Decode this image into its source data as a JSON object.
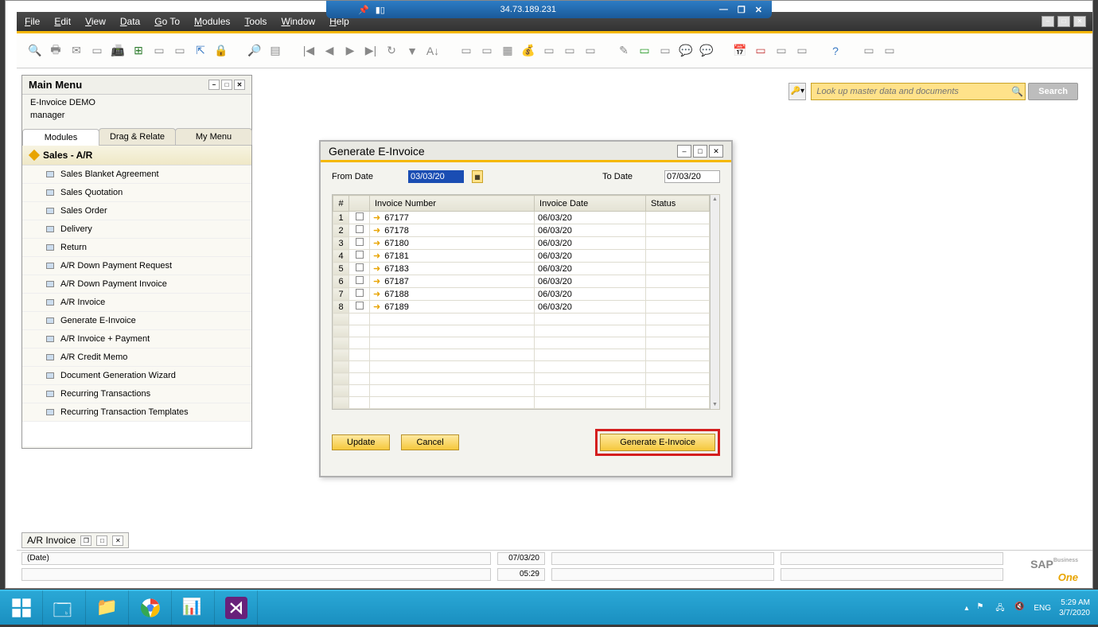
{
  "rdp": {
    "ip": "34.73.189.231"
  },
  "menus": {
    "file": "File",
    "edit": "Edit",
    "view": "View",
    "data": "Data",
    "goto": "Go To",
    "modules": "Modules",
    "tools": "Tools",
    "window": "Window",
    "help": "Help"
  },
  "search": {
    "placeholder": "Look up master data and documents",
    "button": "Search"
  },
  "main_menu": {
    "title": "Main Menu",
    "company": "E-Invoice DEMO",
    "user": "manager",
    "tabs": {
      "modules": "Modules",
      "drag": "Drag & Relate",
      "my": "My Menu"
    },
    "section": "Sales - A/R",
    "items": [
      "Sales Blanket Agreement",
      "Sales Quotation",
      "Sales Order",
      "Delivery",
      "Return",
      "A/R Down Payment Request",
      "A/R Down Payment Invoice",
      "A/R Invoice",
      "Generate E-Invoice",
      "A/R Invoice + Payment",
      "A/R Credit Memo",
      "Document Generation Wizard",
      "Recurring Transactions",
      "Recurring Transaction Templates"
    ]
  },
  "dialog": {
    "title": "Generate E-Invoice",
    "from_label": "From Date",
    "to_label": "To Date",
    "from_date": "03/03/20",
    "to_date": "07/03/20",
    "columns": {
      "num": "#",
      "chk": "",
      "invoice_number": "Invoice Number",
      "invoice_date": "Invoice Date",
      "status": "Status"
    },
    "rows": [
      {
        "n": "1",
        "inv": "67177",
        "date": "06/03/20",
        "status": ""
      },
      {
        "n": "2",
        "inv": "67178",
        "date": "06/03/20",
        "status": ""
      },
      {
        "n": "3",
        "inv": "67180",
        "date": "06/03/20",
        "status": ""
      },
      {
        "n": "4",
        "inv": "67181",
        "date": "06/03/20",
        "status": ""
      },
      {
        "n": "5",
        "inv": "67183",
        "date": "06/03/20",
        "status": ""
      },
      {
        "n": "6",
        "inv": "67187",
        "date": "06/03/20",
        "status": ""
      },
      {
        "n": "7",
        "inv": "67188",
        "date": "06/03/20",
        "status": ""
      },
      {
        "n": "8",
        "inv": "67189",
        "date": "06/03/20",
        "status": ""
      }
    ],
    "buttons": {
      "update": "Update",
      "cancel": "Cancel",
      "generate": "Generate E-Invoice"
    }
  },
  "minimized": {
    "title": "A/R Invoice"
  },
  "status_bar": {
    "hint": "(Date)",
    "date": "07/03/20",
    "time": "05:29"
  },
  "logo": {
    "brand": "SAP",
    "biz": "Business",
    "one": "One"
  },
  "taskbar": {
    "lang": "ENG",
    "time": "5:29 AM",
    "date": "3/7/2020"
  }
}
